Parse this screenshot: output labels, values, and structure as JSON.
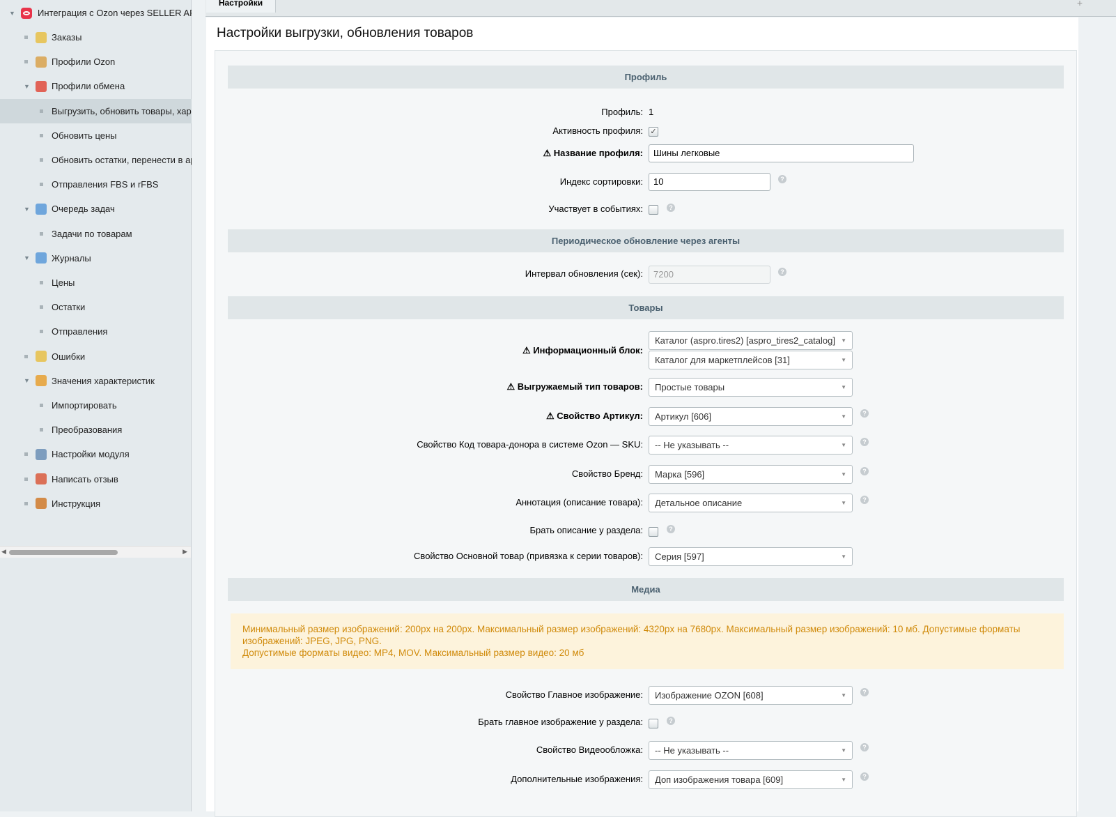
{
  "sidebar": {
    "root": "Интеграция с Ozon через SELLER API",
    "items": [
      {
        "label": "Заказы",
        "level": 1,
        "icon": "bag-icon",
        "color": "#e8c046"
      },
      {
        "label": "Профили Ozon",
        "level": 1,
        "icon": "user-bag-icon",
        "color": "#d9a24b"
      },
      {
        "label": "Профили обмена",
        "level": 1,
        "icon": "exchange-icon",
        "color": "#e04b3c",
        "expanded": true
      },
      {
        "label": "Выгрузить, обновить товары, характеристики",
        "level": 2,
        "selected": true
      },
      {
        "label": "Обновить цены",
        "level": 2
      },
      {
        "label": "Обновить остатки, перенести в архив",
        "level": 2
      },
      {
        "label": "Отправления FBS и rFBS",
        "level": 2
      },
      {
        "label": "Очередь задач",
        "level": 1,
        "icon": "clock-check-icon",
        "color": "#5a9ad8",
        "expanded": true
      },
      {
        "label": "Задачи по товарам",
        "level": 2
      },
      {
        "label": "Журналы",
        "level": 1,
        "icon": "clock-check-icon",
        "color": "#5a9ad8",
        "expanded": true
      },
      {
        "label": "Цены",
        "level": 2
      },
      {
        "label": "Остатки",
        "level": 2
      },
      {
        "label": "Отправления",
        "level": 2
      },
      {
        "label": "Ошибки",
        "level": 1,
        "icon": "document-icon",
        "color": "#e8c046"
      },
      {
        "label": "Значения характеристик",
        "level": 1,
        "icon": "values-icon",
        "color": "#e8a030",
        "expanded": true
      },
      {
        "label": "Импортировать",
        "level": 2
      },
      {
        "label": "Преобразования",
        "level": 2
      },
      {
        "label": "Настройки модуля",
        "level": 1,
        "icon": "tools-icon",
        "color": "#6b8fb5"
      },
      {
        "label": "Написать отзыв",
        "level": 1,
        "icon": "edit-icon",
        "color": "#d95b3c"
      },
      {
        "label": "Инструкция",
        "level": 1,
        "icon": "book-icon",
        "color": "#d07a2a"
      }
    ]
  },
  "tabs": {
    "settings": "Настройки",
    "add": "+"
  },
  "page_title": "Настройки выгрузки, обновления товаров",
  "sections": {
    "profile": "Профиль",
    "agents": "Периодическое обновление через агенты",
    "goods": "Товары",
    "media": "Медиа"
  },
  "fields": {
    "profile_id": {
      "label": "Профиль:",
      "value": "1"
    },
    "active": {
      "label": "Активность профиля:",
      "checked": true
    },
    "name": {
      "label": "⚠ Название профиля:",
      "value": "Шины легковые"
    },
    "sort": {
      "label": "Индекс сортировки:",
      "value": "10"
    },
    "events": {
      "label": "Участвует в событиях:",
      "checked": false
    },
    "interval": {
      "label": "Интервал обновления (сек):",
      "value": "7200"
    },
    "iblock": {
      "label": "⚠ Информационный блок:",
      "value1": "Каталог (aspro.tires2) [aspro_tires2_catalog]",
      "value2": "Каталог для маркетплейсов [31]"
    },
    "type": {
      "label": "⚠ Выгружаемый тип товаров:",
      "value": "Простые товары"
    },
    "article": {
      "label": "⚠ Свойство Артикул:",
      "value": "Артикул [606]"
    },
    "sku": {
      "label": "Свойство Код товара-донора в системе Ozon — SKU:",
      "value": "-- Не указывать --"
    },
    "brand": {
      "label": "Свойство Бренд:",
      "value": "Марка [596]"
    },
    "annotation": {
      "label": "Аннотация (описание товара):",
      "value": "Детальное описание"
    },
    "section_desc": {
      "label": "Брать описание у раздела:",
      "checked": false
    },
    "main_product": {
      "label": "Свойство Основной товар (привязка к серии товаров):",
      "value": "Серия [597]"
    },
    "main_image": {
      "label": "Свойство Главное изображение:",
      "value": "Изображение OZON [608]"
    },
    "section_image": {
      "label": "Брать главное изображение у раздела:",
      "checked": false
    },
    "video_cover": {
      "label": "Свойство Видеообложка:",
      "value": "-- Не указывать --"
    },
    "extra_images": {
      "label": "Дополнительные изображения:",
      "value": "Доп изображения товара [609]"
    }
  },
  "notice": {
    "line1": "Минимальный размер изображений: 200px на 200px. Максимальный размер изображений: 4320px на 7680px. Максимальный размер изображений: 10 мб. Допустимые форматы изображений: JPEG, JPG, PNG.",
    "line2": "Допустимые форматы видео: MP4, MOV. Максимальный размер видео: 20 мб"
  },
  "help_glyph": "?",
  "check_glyph": "✓"
}
